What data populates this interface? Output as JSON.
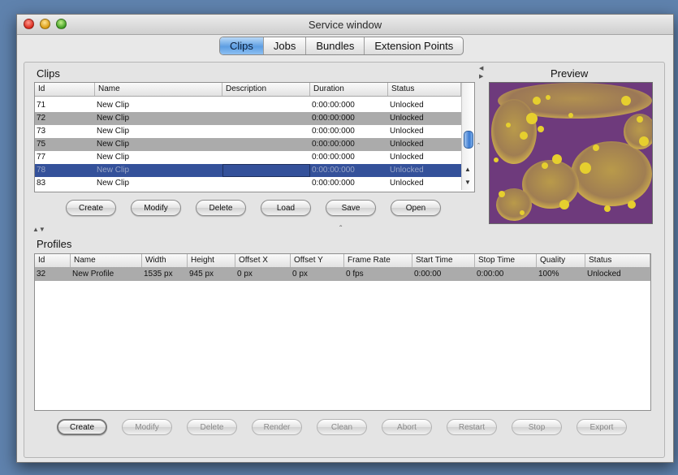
{
  "window": {
    "title": "Service window"
  },
  "tabs": [
    {
      "label": "Clips",
      "active": true
    },
    {
      "label": "Jobs",
      "active": false
    },
    {
      "label": "Bundles",
      "active": false
    },
    {
      "label": "Extension Points",
      "active": false
    }
  ],
  "clips": {
    "section_label": "Clips",
    "columns": [
      "Id",
      "Name",
      "Description",
      "Duration",
      "Status"
    ],
    "rows": [
      {
        "id": "71",
        "name": "New Clip",
        "description": "",
        "duration": "0:00:00:000",
        "status": "Unlocked"
      },
      {
        "id": "72",
        "name": "New Clip",
        "description": "",
        "duration": "0:00:00:000",
        "status": "Unlocked"
      },
      {
        "id": "73",
        "name": "New Clip",
        "description": "",
        "duration": "0:00:00:000",
        "status": "Unlocked"
      },
      {
        "id": "75",
        "name": "New Clip",
        "description": "",
        "duration": "0:00:00:000",
        "status": "Unlocked"
      },
      {
        "id": "77",
        "name": "New Clip",
        "description": "",
        "duration": "0:00:00:000",
        "status": "Unlocked"
      },
      {
        "id": "78",
        "name": "New Clip",
        "description": "",
        "duration": "0:00:00:000",
        "status": "Unlocked",
        "selected": true
      },
      {
        "id": "83",
        "name": "New Clip",
        "description": "",
        "duration": "0:00:00:000",
        "status": "Unlocked"
      }
    ],
    "buttons": [
      "Create",
      "Modify",
      "Delete",
      "Load",
      "Save",
      "Open"
    ]
  },
  "preview": {
    "label": "Preview"
  },
  "profiles": {
    "section_label": "Profiles",
    "columns": [
      "Id",
      "Name",
      "Width",
      "Height",
      "Offset X",
      "Offset Y",
      "Frame Rate",
      "Start Time",
      "Stop Time",
      "Quality",
      "Status"
    ],
    "rows": [
      {
        "id": "32",
        "name": "New Profile",
        "width": "1535 px",
        "height": "945 px",
        "offset_x": "0 px",
        "offset_y": "0 px",
        "frame_rate": "0 fps",
        "start_time": "0:00:00",
        "stop_time": "0:00:00",
        "quality": "100%",
        "status": "Unlocked"
      }
    ],
    "buttons": [
      {
        "label": "Create",
        "enabled": true
      },
      {
        "label": "Modify",
        "enabled": false
      },
      {
        "label": "Delete",
        "enabled": false
      },
      {
        "label": "Render",
        "enabled": false
      },
      {
        "label": "Clean",
        "enabled": false
      },
      {
        "label": "Abort",
        "enabled": false
      },
      {
        "label": "Restart",
        "enabled": false
      },
      {
        "label": "Stop",
        "enabled": false
      },
      {
        "label": "Export",
        "enabled": false
      }
    ]
  },
  "colors": {
    "selection": "#34519a",
    "alt_row": "#ababab",
    "desktop": "#5f82ad",
    "preview_purple": "#6e3a7c",
    "preview_gold": "#d8b63a"
  }
}
